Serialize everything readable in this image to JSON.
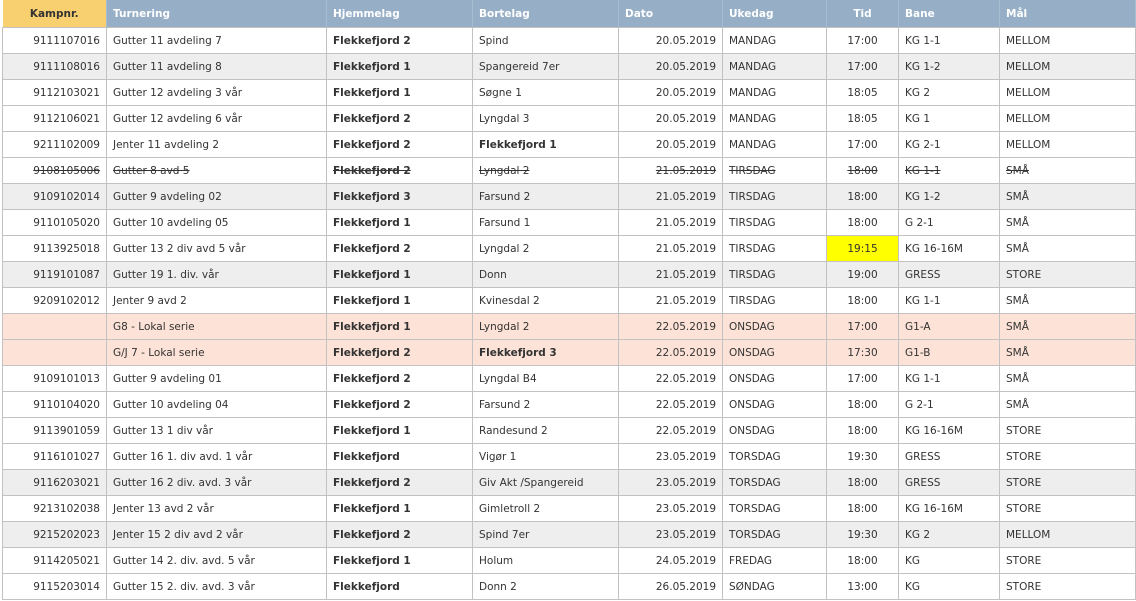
{
  "headers": {
    "kampnr": "Kampnr.",
    "turnering": "Turnering",
    "hjemmelag": "Hjemmelag",
    "bortelag": "Bortelag",
    "dato": "Dato",
    "ukedag": "Ukedag",
    "tid": "Tid",
    "bane": "Bane",
    "maal": "Mål"
  },
  "colors": {
    "header_bg": "#96aec6",
    "kamp_header_bg": "#f8d070",
    "alt_row_bg": "#eeeeee",
    "lokal_row_bg": "#fde3d7",
    "highlight_bg": "#ffff00"
  },
  "rows": [
    {
      "kampnr": "9111107016",
      "turnering": "Gutter 11 avdeling 7",
      "hjemmelag": "Flekkefjord 2",
      "bortelag": "Spind",
      "dato": "20.05.2019",
      "ukedag": "MANDAG",
      "tid": "17:00",
      "bane": "KG 1-1",
      "maal": "MELLOM",
      "style": "",
      "borte_bold": false,
      "tid_hl": false
    },
    {
      "kampnr": "9111108016",
      "turnering": "Gutter 11 avdeling 8",
      "hjemmelag": "Flekkefjord 1",
      "bortelag": "Spangereid 7er",
      "dato": "20.05.2019",
      "ukedag": "MANDAG",
      "tid": "17:00",
      "bane": "KG 1-2",
      "maal": "MELLOM",
      "style": "alt",
      "borte_bold": false,
      "tid_hl": false
    },
    {
      "kampnr": "9112103021",
      "turnering": "Gutter 12 avdeling 3 vår",
      "hjemmelag": "Flekkefjord 1",
      "bortelag": "Søgne 1",
      "dato": "20.05.2019",
      "ukedag": "MANDAG",
      "tid": "18:05",
      "bane": "KG 2",
      "maal": "MELLOM",
      "style": "",
      "borte_bold": false,
      "tid_hl": false
    },
    {
      "kampnr": "9112106021",
      "turnering": "Gutter 12 avdeling 6 vår",
      "hjemmelag": "Flekkefjord 2",
      "bortelag": "Lyngdal 3",
      "dato": "20.05.2019",
      "ukedag": "MANDAG",
      "tid": "18:05",
      "bane": "KG 1",
      "maal": "MELLOM",
      "style": "",
      "borte_bold": false,
      "tid_hl": false
    },
    {
      "kampnr": "9211102009",
      "turnering": "Jenter 11 avdeling 2",
      "hjemmelag": "Flekkefjord 2",
      "bortelag": "Flekkefjord 1",
      "dato": "20.05.2019",
      "ukedag": "MANDAG",
      "tid": "17:00",
      "bane": "KG 2-1",
      "maal": "MELLOM",
      "style": "",
      "borte_bold": true,
      "tid_hl": false
    },
    {
      "kampnr": "9108105006",
      "turnering": "Gutter 8 avd 5",
      "hjemmelag": "Flekkefjord 2",
      "bortelag": "Lyngdal 2",
      "dato": "21.05.2019",
      "ukedag": "TIRSDAG",
      "tid": "18:00",
      "bane": "KG 1-1",
      "maal": "SMÅ",
      "style": "cancel",
      "borte_bold": false,
      "tid_hl": false
    },
    {
      "kampnr": "9109102014",
      "turnering": "Gutter 9 avdeling 02",
      "hjemmelag": "Flekkefjord 3",
      "bortelag": "Farsund 2",
      "dato": "21.05.2019",
      "ukedag": "TIRSDAG",
      "tid": "18:00",
      "bane": "KG 1-2",
      "maal": "SMÅ",
      "style": "alt",
      "borte_bold": false,
      "tid_hl": false
    },
    {
      "kampnr": "9110105020",
      "turnering": "Gutter 10 avdeling 05",
      "hjemmelag": "Flekkefjord 1",
      "bortelag": "Farsund 1",
      "dato": "21.05.2019",
      "ukedag": "TIRSDAG",
      "tid": "18:00",
      "bane": "G 2-1",
      "maal": "SMÅ",
      "style": "",
      "borte_bold": false,
      "tid_hl": false
    },
    {
      "kampnr": "9113925018",
      "turnering": "Gutter 13 2 div avd 5 vår",
      "hjemmelag": "Flekkefjord 2",
      "bortelag": "Lyngdal 2",
      "dato": "21.05.2019",
      "ukedag": "TIRSDAG",
      "tid": "19:15",
      "bane": "KG 16-16M",
      "maal": "SMÅ",
      "style": "",
      "borte_bold": false,
      "tid_hl": true
    },
    {
      "kampnr": "9119101087",
      "turnering": "Gutter 19 1. div. vår",
      "hjemmelag": "Flekkefjord 1",
      "bortelag": "Donn",
      "dato": "21.05.2019",
      "ukedag": "TIRSDAG",
      "tid": "19:00",
      "bane": "GRESS",
      "maal": "STORE",
      "style": "alt",
      "borte_bold": false,
      "tid_hl": false
    },
    {
      "kampnr": "9209102012",
      "turnering": "Jenter 9 avd 2",
      "hjemmelag": "Flekkefjord 1",
      "bortelag": "Kvinesdal 2",
      "dato": "21.05.2019",
      "ukedag": "TIRSDAG",
      "tid": "18:00",
      "bane": "KG 1-1",
      "maal": "SMÅ",
      "style": "",
      "borte_bold": false,
      "tid_hl": false
    },
    {
      "kampnr": "",
      "turnering": "G8 - Lokal serie",
      "hjemmelag": "Flekkefjord 1",
      "bortelag": "Lyngdal 2",
      "dato": "22.05.2019",
      "ukedag": "ONSDAG",
      "tid": "17:00",
      "bane": "G1-A",
      "maal": "SMÅ",
      "style": "lokal",
      "borte_bold": false,
      "tid_hl": false
    },
    {
      "kampnr": "",
      "turnering": "G/J 7 - Lokal serie",
      "hjemmelag": "Flekkefjord 2",
      "bortelag": "Flekkefjord 3",
      "dato": "22.05.2019",
      "ukedag": "ONSDAG",
      "tid": "17:30",
      "bane": "G1-B",
      "maal": "SMÅ",
      "style": "lokal",
      "borte_bold": true,
      "tid_hl": false
    },
    {
      "kampnr": "9109101013",
      "turnering": "Gutter 9 avdeling 01",
      "hjemmelag": "Flekkefjord 2",
      "bortelag": "Lyngdal B4",
      "dato": "22.05.2019",
      "ukedag": "ONSDAG",
      "tid": "17:00",
      "bane": "KG 1-1",
      "maal": "SMÅ",
      "style": "",
      "borte_bold": false,
      "tid_hl": false
    },
    {
      "kampnr": "9110104020",
      "turnering": "Gutter 10 avdeling 04",
      "hjemmelag": "Flekkefjord 2",
      "bortelag": "Farsund 2",
      "dato": "22.05.2019",
      "ukedag": "ONSDAG",
      "tid": "18:00",
      "bane": "G 2-1",
      "maal": "SMÅ",
      "style": "",
      "borte_bold": false,
      "tid_hl": false
    },
    {
      "kampnr": "9113901059",
      "turnering": "Gutter 13 1 div vår",
      "hjemmelag": "Flekkefjord 1",
      "bortelag": "Randesund 2",
      "dato": "22.05.2019",
      "ukedag": "ONSDAG",
      "tid": "18:00",
      "bane": "KG 16-16M",
      "maal": "STORE",
      "style": "",
      "borte_bold": false,
      "tid_hl": false
    },
    {
      "kampnr": "9116101027",
      "turnering": "Gutter 16 1. div avd. 1 vår",
      "hjemmelag": "Flekkefjord",
      "bortelag": "Vigør 1",
      "dato": "23.05.2019",
      "ukedag": "TORSDAG",
      "tid": "19:30",
      "bane": "GRESS",
      "maal": "STORE",
      "style": "",
      "borte_bold": false,
      "tid_hl": false
    },
    {
      "kampnr": "9116203021",
      "turnering": "Gutter 16 2 div. avd. 3 vår",
      "hjemmelag": "Flekkefjord 2",
      "bortelag": "Giv Akt /Spangereid",
      "dato": "23.05.2019",
      "ukedag": "TORSDAG",
      "tid": "18:00",
      "bane": "GRESS",
      "maal": "STORE",
      "style": "alt",
      "borte_bold": false,
      "tid_hl": false
    },
    {
      "kampnr": "9213102038",
      "turnering": "Jenter 13 avd 2 vår",
      "hjemmelag": "Flekkefjord 1",
      "bortelag": "Gimletroll 2",
      "dato": "23.05.2019",
      "ukedag": "TORSDAG",
      "tid": "18:00",
      "bane": "KG 16-16M",
      "maal": "STORE",
      "style": "",
      "borte_bold": false,
      "tid_hl": false
    },
    {
      "kampnr": "9215202023",
      "turnering": "Jenter 15 2 div avd 2 vår",
      "hjemmelag": "Flekkefjord 2",
      "bortelag": "Spind 7er",
      "dato": "23.05.2019",
      "ukedag": "TORSDAG",
      "tid": "19:30",
      "bane": "KG 2",
      "maal": "MELLOM",
      "style": "alt",
      "borte_bold": false,
      "tid_hl": false
    },
    {
      "kampnr": "9114205021",
      "turnering": "Gutter 14 2. div. avd. 5 vår",
      "hjemmelag": "Flekkefjord 1",
      "bortelag": "Holum",
      "dato": "24.05.2019",
      "ukedag": "FREDAG",
      "tid": "18:00",
      "bane": "KG",
      "maal": "STORE",
      "style": "",
      "borte_bold": false,
      "tid_hl": false
    },
    {
      "kampnr": "9115203014",
      "turnering": "Gutter 15 2. div. avd. 3 vår",
      "hjemmelag": "Flekkefjord",
      "bortelag": "Donn 2",
      "dato": "26.05.2019",
      "ukedag": "SØNDAG",
      "tid": "13:00",
      "bane": "KG",
      "maal": "STORE",
      "style": "",
      "borte_bold": false,
      "tid_hl": false
    }
  ]
}
